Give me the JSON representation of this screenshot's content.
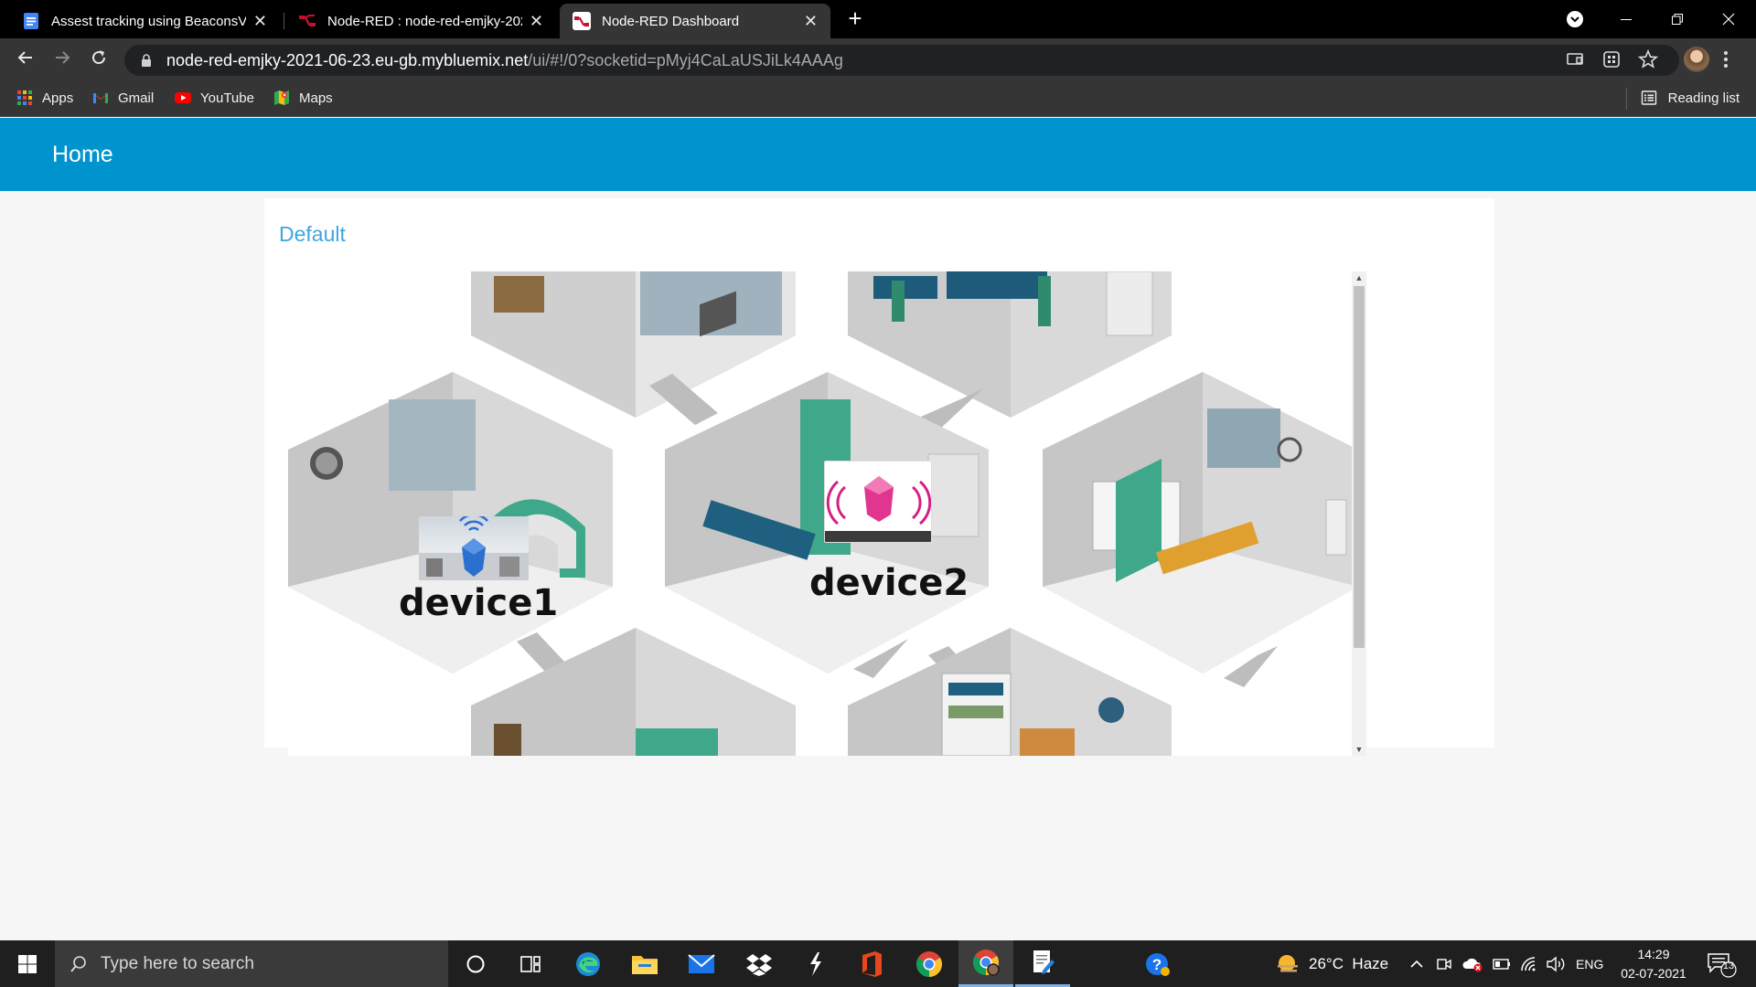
{
  "browser": {
    "tabs": [
      {
        "title": "Assest tracking using BeaconsV -",
        "active": false
      },
      {
        "title": "Node-RED : node-red-emjky-202",
        "active": false
      },
      {
        "title": "Node-RED Dashboard",
        "active": true
      }
    ],
    "url_host": "node-red-emjky-2021-06-23.eu-gb.mybluemix.net",
    "url_path": "/ui/#!/0?socketid=pMyj4CaLaUSJiLk4AAAg",
    "bookmarks": [
      {
        "label": "Apps",
        "icon": "apps-grid-icon"
      },
      {
        "label": "Gmail",
        "icon": "gmail-icon"
      },
      {
        "label": "YouTube",
        "icon": "youtube-icon"
      },
      {
        "label": "Maps",
        "icon": "maps-icon"
      }
    ],
    "reading_list": "Reading list"
  },
  "dashboard": {
    "header_title": "Home",
    "header_color": "#0094ce",
    "group_title": "Default",
    "group_title_color": "#3fa5e0",
    "devices": [
      {
        "label": "device1"
      },
      {
        "label": "device2"
      }
    ]
  },
  "taskbar": {
    "search_placeholder": "Type here to search",
    "weather": "26°C  Haze",
    "language": "ENG",
    "time": "14:29",
    "date": "02-07-2021",
    "notifications": "13"
  }
}
